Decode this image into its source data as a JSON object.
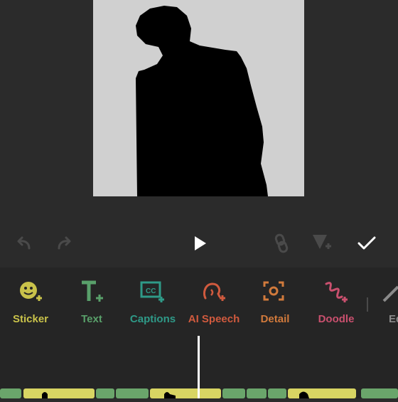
{
  "colors": {
    "background": "#2b2b2b",
    "toolbar_bg": "#252525",
    "sticker": "#c9c24a",
    "text": "#59a06a",
    "captions": "#2f9a88",
    "ai_speech": "#d05a3e",
    "detail": "#d17a3c",
    "doodle": "#c9506e",
    "edit": "#8a8a8a",
    "strip_yellow": "#d8d563",
    "strip_green": "#6aa56b"
  },
  "controls": {
    "undo_icon": "undo-icon",
    "redo_icon": "redo-icon",
    "play_icon": "play-icon",
    "link_icon": "link-icon",
    "keyframe_icon": "keyframe-add-icon",
    "confirm_icon": "check-icon"
  },
  "tools": [
    {
      "label": "Sticker",
      "icon": "sticker-icon"
    },
    {
      "label": "Text",
      "icon": "text-icon"
    },
    {
      "label": "Captions",
      "icon": "captions-icon"
    },
    {
      "label": "AI Speech",
      "icon": "ai-speech-icon"
    },
    {
      "label": "Detail",
      "icon": "detail-icon"
    },
    {
      "label": "Doodle",
      "icon": "doodle-icon"
    },
    {
      "label": "Ed",
      "icon": "edit-icon"
    }
  ]
}
